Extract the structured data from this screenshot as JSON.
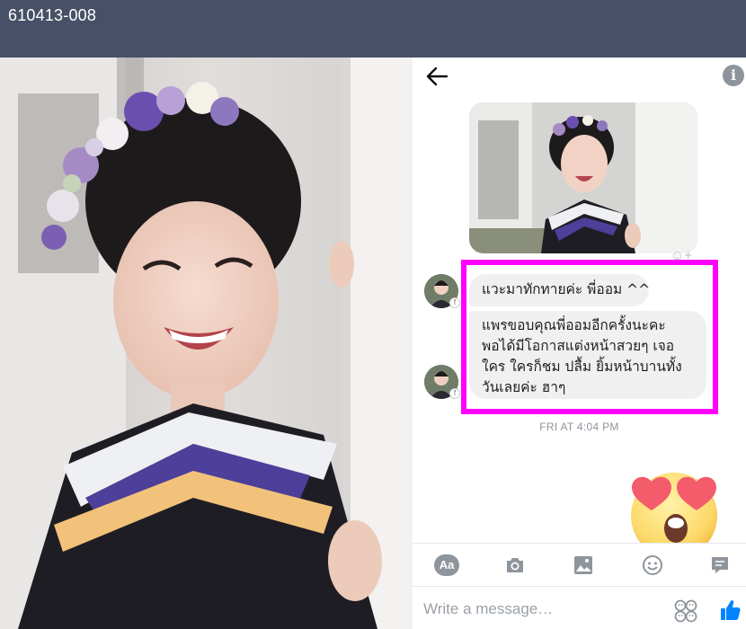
{
  "header": {
    "code": "610413-008"
  },
  "messenger": {
    "icons": {
      "back": "back-arrow-icon",
      "info": "info-icon"
    },
    "info_glyph": "i",
    "messages": [
      {
        "sender": "contact",
        "text": "แวะมาทักทายค่ะ พี่ออม ^^"
      },
      {
        "sender": "contact",
        "text": "แพรขอบคุณพี่ออมอีกครั้งนะคะ พอได้มีโอกาสแต่งหน้าสวยๆ เจอใคร ใครก็ชม ปลื้ม ยิ้มหน้าบานทั้งวันเลยค่ะ ฮาๆ"
      }
    ],
    "highlight_color": "#ff00ff",
    "timestamp": "FRI AT 4:04 PM",
    "reply_sticker": "heart-eyes-emoji",
    "toolbar": {
      "aa_label": "Aa",
      "icons": [
        "text-format-icon",
        "camera-icon",
        "gallery-icon",
        "emoji-icon",
        "chat-icon"
      ]
    },
    "composer": {
      "placeholder": "Write a message…",
      "icons": [
        "sticker-icon",
        "like-thumb-icon"
      ]
    }
  },
  "colors": {
    "header_bg": "#475066",
    "like_blue": "#0084ff",
    "bubble_bg": "#f1f0f0"
  }
}
